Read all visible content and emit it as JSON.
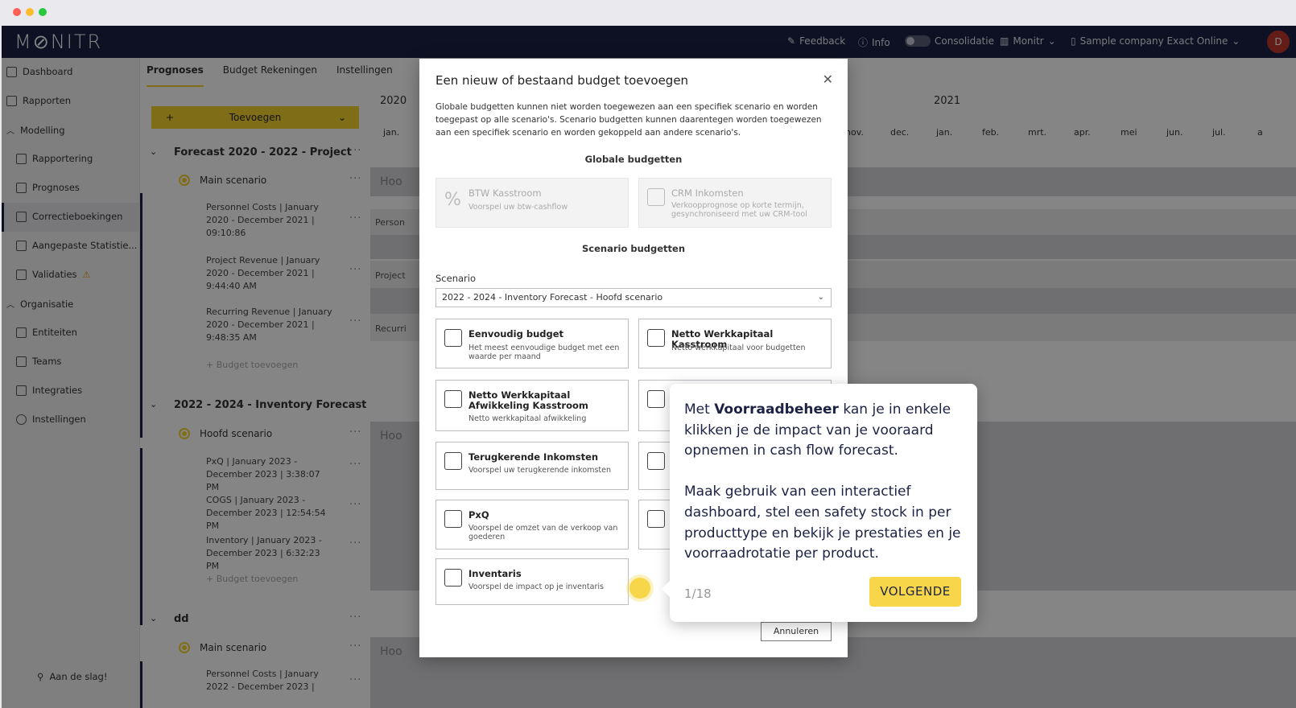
{
  "header": {
    "logo": "M⊘NITR",
    "feedback": "Feedback",
    "info": "Info",
    "consolidatie": "Consolidatie",
    "monitr_menu": "Monitr",
    "company": "Sample company Exact Online",
    "avatar_initial": "D"
  },
  "sidebar": {
    "items": [
      {
        "label": "Dashboard"
      },
      {
        "label": "Rapporten"
      },
      {
        "label": "Modelling"
      },
      {
        "label": "Rapportering"
      },
      {
        "label": "Prognoses"
      },
      {
        "label": "Correctieboekingen"
      },
      {
        "label": "Aangepaste Statistie..."
      },
      {
        "label": "Validaties"
      },
      {
        "label": "Organisatie"
      },
      {
        "label": "Entiteiten"
      },
      {
        "label": "Teams"
      },
      {
        "label": "Integraties"
      },
      {
        "label": "Instellingen"
      }
    ],
    "get_started": "Aan de slag!"
  },
  "tabs": [
    "Prognoses",
    "Budget Rekeningen",
    "Instellingen"
  ],
  "add_button": "Toevoegen",
  "tree": {
    "forecast1_title": "Forecast 2020 - 2022 - Project",
    "main_scenario": "Main scenario",
    "item_personnel": "Personnel Costs | January 2020 - December 2021 | 09:10:86",
    "item_project": "Project Revenue | January 2020 - December 2021 | 9:44:40 AM",
    "item_recurring": "Recurring Revenue | January 2020 - December 2021 | 9:48:35 AM",
    "budget_add": "Budget toevoegen",
    "forecast2_title": "2022 - 2024 - Inventory Forecast",
    "hoofd_scenario": "Hoofd scenario",
    "item_pxq": "PxQ | January 2023 - December 2023 | 3:38:07 PM",
    "item_cogs": "COGS | January 2023 - December 2023 | 12:54:54 PM",
    "item_inventory": "Inventory | January 2023 - December 2023 | 6:32:23 PM",
    "budget_add2": "Budget toevoegen",
    "forecast3_title": "dd",
    "main_scenario3": "Main scenario",
    "item_personnel3": "Personnel Costs | January 2022 - December 2023 |"
  },
  "timeline": {
    "year1": "2020",
    "year2": "2021",
    "months_start": "jan.",
    "months_visible": [
      "nov.",
      "dec.",
      "jan.",
      "feb.",
      "mrt.",
      "apr.",
      "mei",
      "jun.",
      "jul.",
      "a"
    ],
    "band_hoofd": "Hoo",
    "band_personnel": "Person",
    "band_project": "Project",
    "band_recurring": "Recurri"
  },
  "modal": {
    "title": "Een nieuw of bestaand budget toevoegen",
    "description": "Globale budgetten kunnen niet worden toegewezen aan een specifiek scenario en worden toegepast op alle scenario's. Scenario budgetten kunnen daarentegen worden toegewezen aan een specifiek scenario en worden gekoppeld aan andere scenario's.",
    "global_title": "Globale budgetten",
    "scenario_title": "Scenario budgetten",
    "global_cards": [
      {
        "title": "BTW Kasstroom",
        "sub": "Voorspel uw btw-cashflow"
      },
      {
        "title": "CRM Inkomsten",
        "sub": "Verkoopprognose op korte termijn, gesynchroniseerd met uw CRM-tool"
      }
    ],
    "scenario_label": "Scenario",
    "scenario_value": "2022 - 2024 - Inventory Forecast - Hoofd scenario",
    "cards": [
      {
        "title": "Eenvoudig budget",
        "sub": "Het meest eenvoudige budget met een waarde per maand"
      },
      {
        "title": "Netto Werkkapitaal Kasstroom",
        "sub": "Netto werkkapitaal voor budgetten"
      },
      {
        "title": "Netto Werkkapitaal Afwikkeling Kasstroom",
        "sub": "Netto werkkapitaal afwikkeling"
      },
      {
        "title": "Terugkerende Inkomsten",
        "sub": "Voorspel uw terugkerende inkomsten"
      },
      {
        "title": "PxQ",
        "sub": "Voorspel de omzet van de verkoop van goederen"
      },
      {
        "title": "Inventaris",
        "sub": "Voorspel de impact op je inventaris"
      }
    ],
    "cancel": "Annuleren"
  },
  "tour": {
    "text_pre": "Met ",
    "text_bold": "Voorraadbeheer",
    "text_post": " kan je in enkele klikken je de impact van je vooraard opnemen in cash flow forecast.",
    "text_para2": "Maak gebruik van een interactief dashboard, stel een safety stock in per producttype en bekijk je prestaties en je voorraadrotatie per product.",
    "counter": "1/18",
    "next": "VOLGENDE"
  },
  "colors": {
    "navy": "#1c2244",
    "accent": "#f4d12e",
    "beacon": "#f7d64a",
    "danger": "#c0392b"
  }
}
